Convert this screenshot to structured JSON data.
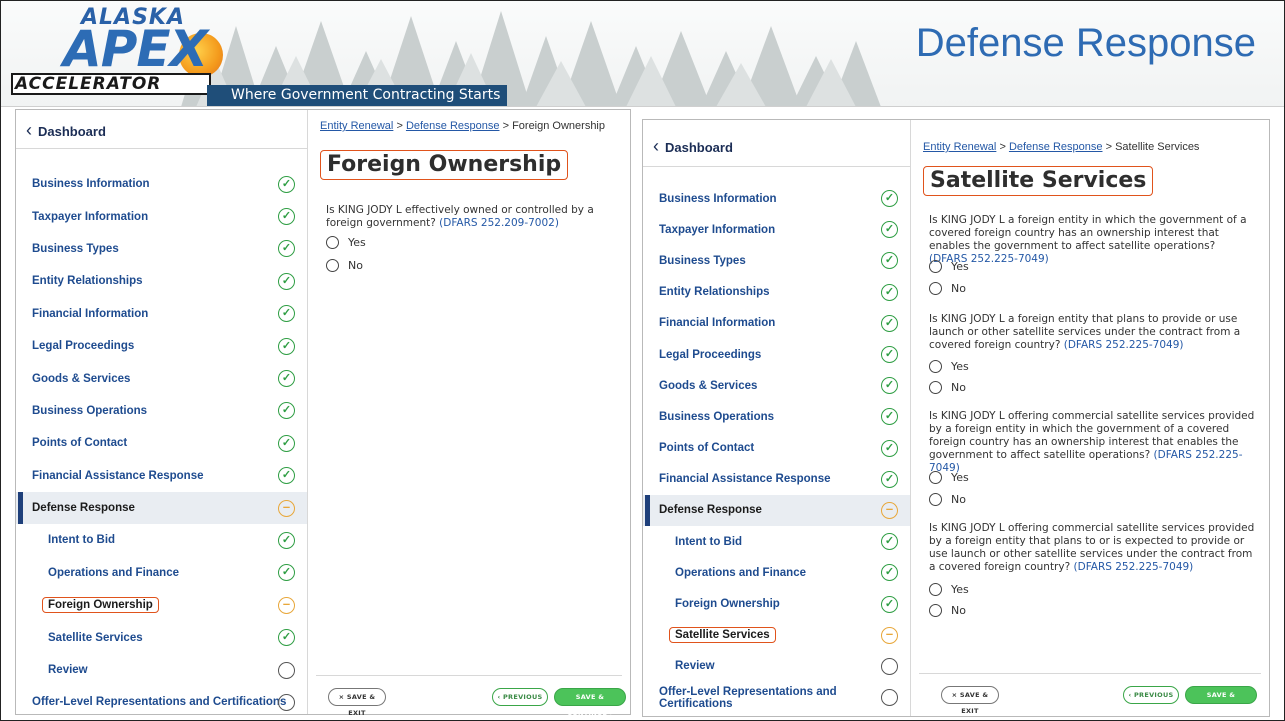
{
  "header": {
    "logo_top": "ALASKA",
    "logo_main": "APEX",
    "logo_bottom": "ACCELERATOR",
    "tagline": "Where Government Contracting Starts",
    "slide_title": "Defense Response"
  },
  "left": {
    "dashboard": "Dashboard",
    "nav": [
      {
        "label": "Business Information",
        "status": "complete"
      },
      {
        "label": "Taxpayer Information",
        "status": "complete"
      },
      {
        "label": "Business Types",
        "status": "complete"
      },
      {
        "label": "Entity Relationships",
        "status": "complete"
      },
      {
        "label": "Financial Information",
        "status": "complete"
      },
      {
        "label": "Legal Proceedings",
        "status": "complete"
      },
      {
        "label": "Goods & Services",
        "status": "complete"
      },
      {
        "label": "Business Operations",
        "status": "complete"
      },
      {
        "label": "Points of Contact",
        "status": "complete"
      },
      {
        "label": "Financial Assistance Response",
        "status": "complete"
      },
      {
        "label": "Defense Response",
        "status": "partial"
      },
      {
        "label": "Intent to Bid",
        "status": "complete"
      },
      {
        "label": "Operations and Finance",
        "status": "complete"
      },
      {
        "label": "Foreign Ownership",
        "status": "partial"
      },
      {
        "label": "Satellite Services",
        "status": "complete"
      },
      {
        "label": "Review",
        "status": "empty"
      },
      {
        "label": "Offer-Level Representations and Certifications",
        "status": "empty"
      }
    ],
    "breadcrumb": {
      "link1": "Entity Renewal",
      "sep": ">",
      "link2": "Defense Response",
      "current": "Foreign Ownership"
    },
    "heading": "Foreign Ownership",
    "question": {
      "text": "Is KING JODY L effectively owned or controlled by a foreign government?",
      "ref": "(DFARS 252.209-7002)"
    },
    "options": [
      "Yes",
      "No"
    ],
    "buttons": {
      "save_exit": "×  SAVE & EXIT",
      "previous": "‹  PREVIOUS",
      "continue": "SAVE & CONTINUE  ›"
    }
  },
  "right": {
    "dashboard": "Dashboard",
    "nav": [
      {
        "label": "Business Information",
        "status": "complete"
      },
      {
        "label": "Taxpayer Information",
        "status": "complete"
      },
      {
        "label": "Business Types",
        "status": "complete"
      },
      {
        "label": "Entity Relationships",
        "status": "complete"
      },
      {
        "label": "Financial Information",
        "status": "complete"
      },
      {
        "label": "Legal Proceedings",
        "status": "complete"
      },
      {
        "label": "Goods & Services",
        "status": "complete"
      },
      {
        "label": "Business Operations",
        "status": "complete"
      },
      {
        "label": "Points of Contact",
        "status": "complete"
      },
      {
        "label": "Financial Assistance Response",
        "status": "complete"
      },
      {
        "label": "Defense Response",
        "status": "partial"
      },
      {
        "label": "Intent to Bid",
        "status": "complete"
      },
      {
        "label": "Operations and Finance",
        "status": "complete"
      },
      {
        "label": "Foreign Ownership",
        "status": "complete"
      },
      {
        "label": "Satellite Services",
        "status": "partial"
      },
      {
        "label": "Review",
        "status": "empty"
      },
      {
        "label": "Offer-Level Representations and Certifications",
        "status": "empty"
      }
    ],
    "breadcrumb": {
      "link1": "Entity Renewal",
      "sep": ">",
      "link2": "Defense Response",
      "current": "Satellite Services"
    },
    "heading": "Satellite Services",
    "questions": [
      {
        "text": "Is KING JODY L a foreign entity in which the government of a covered foreign country has an ownership interest that enables the government to affect satellite operations?",
        "ref": "(DFARS 252.225-7049)"
      },
      {
        "text": "Is KING JODY L a foreign entity that plans to provide or use launch or other satellite services under the contract from a covered foreign country?",
        "ref": "(DFARS 252.225-7049)"
      },
      {
        "text": "Is KING JODY L offering commercial satellite services provided by a foreign entity in which the government of a covered foreign country has an ownership interest that enables the government to affect satellite operations?",
        "ref": "(DFARS 252.225-7049)"
      },
      {
        "text": "Is KING JODY L offering commercial satellite services provided by a foreign entity that plans to or is expected to provide or use launch or other satellite services under the contract from a covered foreign country?",
        "ref": "(DFARS 252.225-7049)"
      }
    ],
    "options": [
      "Yes",
      "No"
    ],
    "buttons": {
      "save_exit": "×  SAVE & EXIT",
      "previous": "‹  PREVIOUS",
      "continue": "SAVE & CONTINUE  ›"
    }
  }
}
